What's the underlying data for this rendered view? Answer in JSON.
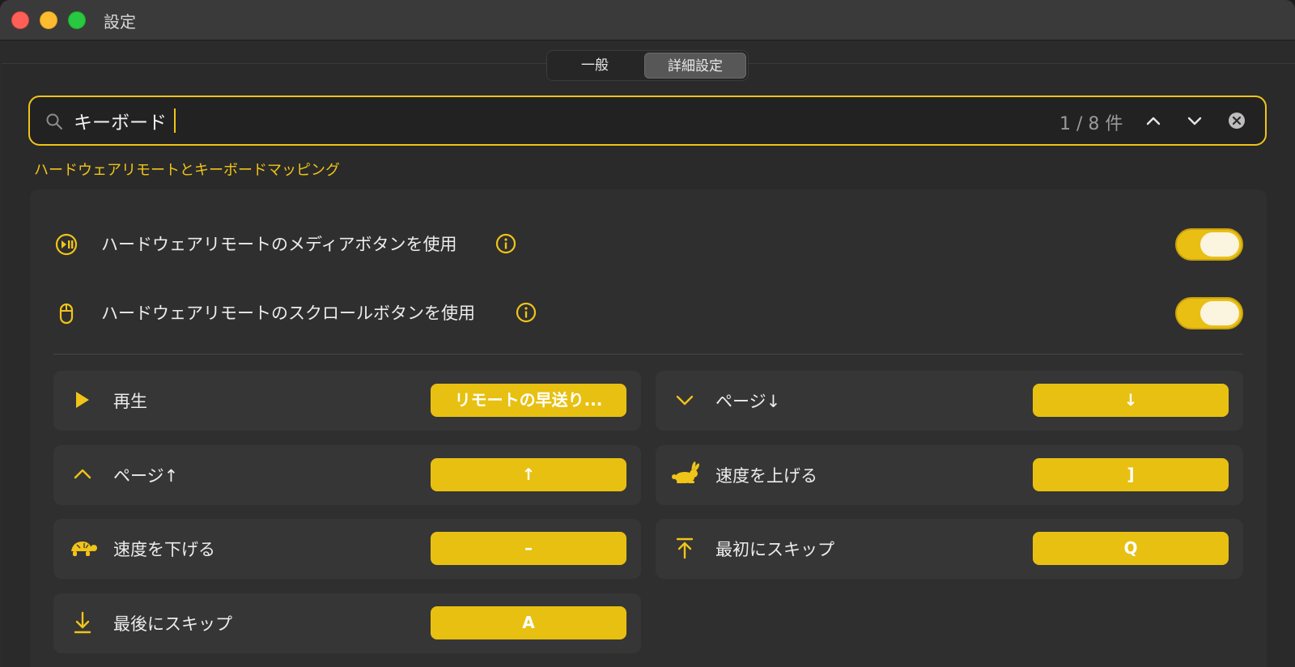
{
  "window": {
    "title": "設定"
  },
  "tabs": [
    {
      "label": "一般",
      "selected": false
    },
    {
      "label": "詳細設定",
      "selected": true
    }
  ],
  "search": {
    "query": "キーボード",
    "count": "1 / 8 件"
  },
  "section": {
    "title": "ハードウェアリモートとキーボードマッピング"
  },
  "toggles": [
    {
      "icon": "play-pause-circle-icon",
      "label": "ハードウェアリモートのメディアボタンを使用",
      "on": true
    },
    {
      "icon": "mouse-icon",
      "label": "ハードウェアリモートのスクロールボタンを使用",
      "on": true
    }
  ],
  "mappings": [
    {
      "icon": "play-icon",
      "label": "再生",
      "key": "リモートの早送り..."
    },
    {
      "icon": "chevron-down-icon",
      "label": "ページ↓",
      "key": "↓"
    },
    {
      "icon": "chevron-up-icon",
      "label": "ページ↑",
      "key": "↑"
    },
    {
      "icon": "rabbit-icon",
      "label": "速度を上げる",
      "key": "]"
    },
    {
      "icon": "turtle-icon",
      "label": "速度を下げる",
      "key": "–"
    },
    {
      "icon": "skip-to-start-icon",
      "label": "最初にスキップ",
      "key": "Q"
    },
    {
      "icon": "skip-to-end-icon",
      "label": "最後にスキップ",
      "key": "A"
    }
  ],
  "colors": {
    "accent": "#f0c419",
    "background": "#2a2a2a",
    "panel": "#2f2f2f",
    "card": "#363636"
  }
}
